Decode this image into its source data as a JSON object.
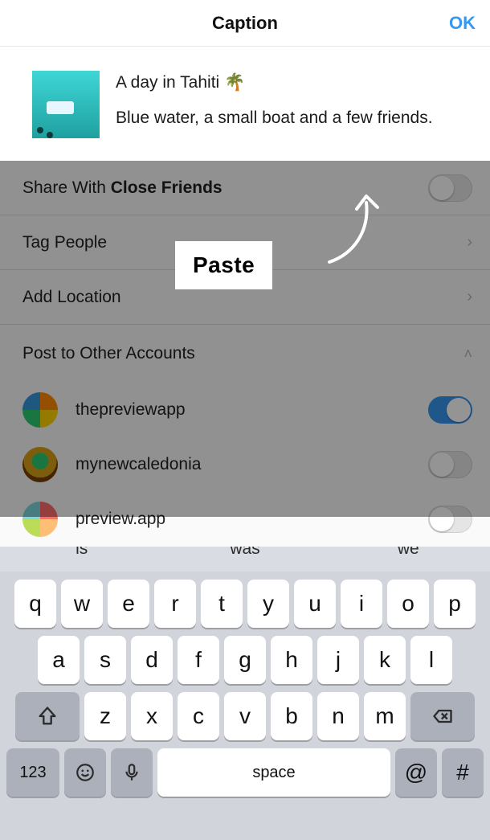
{
  "header": {
    "title": "Caption",
    "ok": "OK"
  },
  "caption": {
    "line1": "A day in Tahiti 🌴",
    "line2": "Blue water, a small boat and a few friends."
  },
  "rows": {
    "shareWithPrefix": "Share With ",
    "shareWithBold": "Close Friends",
    "tagPeople": "Tag People",
    "addLocation": "Add Location",
    "postOther": "Post to Other Accounts"
  },
  "accounts": [
    {
      "name": "thepreviewapp",
      "on": true
    },
    {
      "name": "mynewcaledonia",
      "on": false
    },
    {
      "name": "preview.app",
      "on": false
    }
  ],
  "callout": {
    "paste": "Paste"
  },
  "keyboard": {
    "suggestions": [
      "is",
      "was",
      "we"
    ],
    "row1": [
      "q",
      "w",
      "e",
      "r",
      "t",
      "y",
      "u",
      "i",
      "o",
      "p"
    ],
    "row2": [
      "a",
      "s",
      "d",
      "f",
      "g",
      "h",
      "j",
      "k",
      "l"
    ],
    "row3": [
      "z",
      "x",
      "c",
      "v",
      "b",
      "n",
      "m"
    ],
    "numKey": "123",
    "space": "space",
    "at": "@",
    "hash": "#"
  }
}
